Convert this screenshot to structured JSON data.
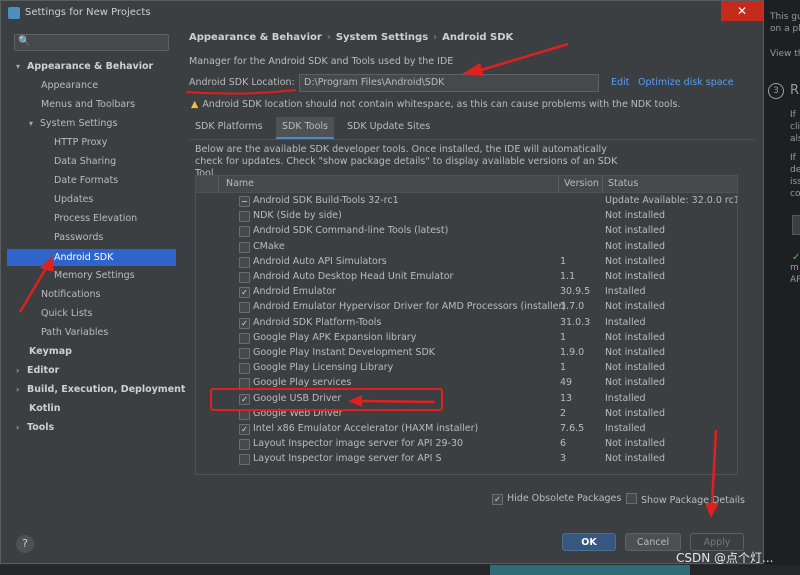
{
  "window": {
    "title": "Settings for New Projects",
    "close_glyph": "✕"
  },
  "search": {
    "placeholder": "",
    "icon_glyph": "🔍"
  },
  "sidebar": {
    "items": [
      {
        "label": "Appearance & Behavior",
        "arrow": "▾",
        "bold": true
      },
      {
        "label": "Appearance"
      },
      {
        "label": "Menus and Toolbars"
      },
      {
        "label": "System Settings",
        "arrow": "▾"
      },
      {
        "label": "HTTP Proxy"
      },
      {
        "label": "Data Sharing"
      },
      {
        "label": "Date Formats"
      },
      {
        "label": "Updates"
      },
      {
        "label": "Process Elevation"
      },
      {
        "label": "Passwords"
      },
      {
        "label": "Android SDK",
        "selected": true
      },
      {
        "label": "Memory Settings"
      },
      {
        "label": "Notifications"
      },
      {
        "label": "Quick Lists"
      },
      {
        "label": "Path Variables"
      },
      {
        "label": "Keymap",
        "bold": true
      },
      {
        "label": "Editor",
        "arrow": "›",
        "bold": true
      },
      {
        "label": "Build, Execution, Deployment",
        "arrow": "›",
        "bold": true
      },
      {
        "label": "Kotlin",
        "bold": true
      },
      {
        "label": "Tools",
        "arrow": "›",
        "bold": true
      }
    ]
  },
  "breadcrumb": {
    "part1": "Appearance & Behavior",
    "part2": "System Settings",
    "part3": "Android SDK",
    "sep": "›"
  },
  "main": {
    "description": "Manager for the Android SDK and Tools used by the IDE",
    "location_label": "Android SDK Location:",
    "location_value": "D:\\Program Files\\Android\\SDK",
    "edit_link": "Edit",
    "optimize_link": "Optimize disk space",
    "warning_icon": "▲",
    "warning": "Android SDK location should not contain whitespace, as this can cause problems with the NDK tools.",
    "tabs": [
      "SDK Platforms",
      "SDK Tools",
      "SDK Update Sites"
    ],
    "info": "Below are the available SDK developer tools. Once installed, the IDE will automatically check for updates. Check \"show package details\" to display available versions of an SDK Tool."
  },
  "table": {
    "headers": {
      "name": "Name",
      "version": "Version",
      "status": "Status"
    },
    "rows": [
      {
        "mark": "−",
        "name": "Android SDK Build-Tools 32-rc1",
        "version": "",
        "status": "Update Available: 32.0.0 rc1"
      },
      {
        "mark": "",
        "name": "NDK (Side by side)",
        "version": "",
        "status": "Not installed"
      },
      {
        "mark": "",
        "name": "Android SDK Command-line Tools (latest)",
        "version": "",
        "status": "Not installed"
      },
      {
        "mark": "",
        "name": "CMake",
        "version": "",
        "status": "Not installed"
      },
      {
        "mark": "",
        "name": "Android Auto API Simulators",
        "version": "1",
        "status": "Not installed"
      },
      {
        "mark": "",
        "name": "Android Auto Desktop Head Unit Emulator",
        "version": "1.1",
        "status": "Not installed"
      },
      {
        "mark": "✓",
        "name": "Android Emulator",
        "version": "30.9.5",
        "status": "Installed"
      },
      {
        "mark": "",
        "name": "Android Emulator Hypervisor Driver for AMD Processors (installer)",
        "version": "1.7.0",
        "status": "Not installed"
      },
      {
        "mark": "✓",
        "name": "Android SDK Platform-Tools",
        "version": "31.0.3",
        "status": "Installed"
      },
      {
        "mark": "",
        "name": "Google Play APK Expansion library",
        "version": "1",
        "status": "Not installed"
      },
      {
        "mark": "",
        "name": "Google Play Instant Development SDK",
        "version": "1.9.0",
        "status": "Not installed"
      },
      {
        "mark": "",
        "name": "Google Play Licensing Library",
        "version": "1",
        "status": "Not installed"
      },
      {
        "mark": "",
        "name": "Google Play services",
        "version": "49",
        "status": "Not installed"
      },
      {
        "mark": "✓",
        "name": "Google USB Driver",
        "version": "13",
        "status": "Installed"
      },
      {
        "mark": "",
        "name": "Google Web Driver",
        "version": "2",
        "status": "Not installed"
      },
      {
        "mark": "✓",
        "name": "Intel x86 Emulator Accelerator (HAXM installer)",
        "version": "7.6.5",
        "status": "Installed"
      },
      {
        "mark": "",
        "name": "Layout Inspector image server for API 29-30",
        "version": "6",
        "status": "Not installed"
      },
      {
        "mark": "",
        "name": "Layout Inspector image server for API S",
        "version": "3",
        "status": "Not installed"
      }
    ]
  },
  "options": {
    "hide_obsolete": "Hide Obsolete Packages",
    "hide_obsolete_mark": "✓",
    "show_details": "Show Package Details"
  },
  "buttons": {
    "help": "?",
    "ok": "OK",
    "cancel": "Cancel",
    "apply": "Apply"
  },
  "background_panel": {
    "lines": [
      "This gu",
      "on a pl",
      "View th",
      "R",
      "If",
      "cli",
      "als",
      "If",
      "de",
      "iss",
      "co",
      "m",
      "AP"
    ],
    "step": "3",
    "check_glyph": "✓"
  },
  "watermark": "CSDN @点个灯...",
  "colors": {
    "accent": "#2f65ca",
    "link": "#589df6",
    "annotation": "#e0201e",
    "warning": "#f0c040"
  }
}
